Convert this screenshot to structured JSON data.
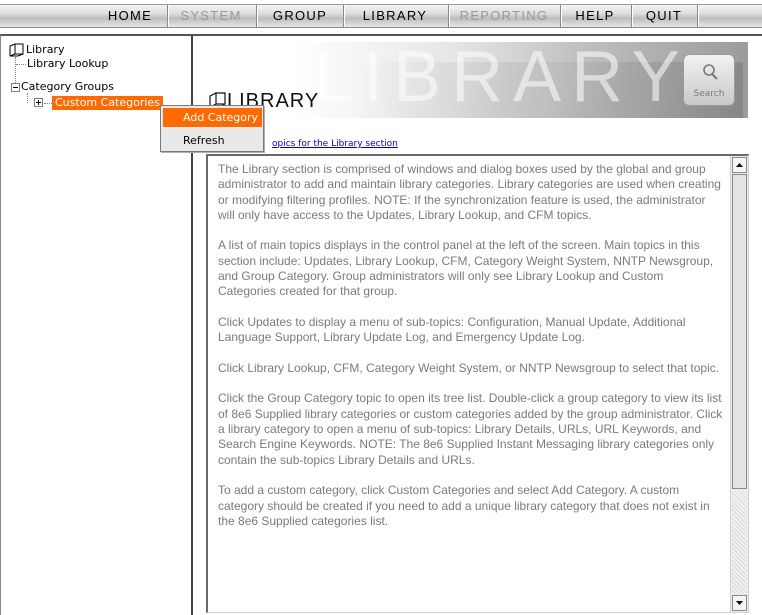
{
  "menu": {
    "items": [
      {
        "label": "HOME",
        "enabled": true
      },
      {
        "label": "SYSTEM",
        "enabled": false
      },
      {
        "label": "GROUP",
        "enabled": true
      },
      {
        "label": "LIBRARY",
        "enabled": true
      },
      {
        "label": "REPORTING",
        "enabled": false
      },
      {
        "label": "HELP",
        "enabled": true
      },
      {
        "label": "QUIT",
        "enabled": true
      }
    ]
  },
  "tree": {
    "root_label": "Library",
    "lookup_label": "Library Lookup",
    "category_groups_label": "Category Groups",
    "custom_categories_label": "Custom Categories"
  },
  "context_menu": {
    "items": [
      {
        "label": "Add Category",
        "active": true
      },
      {
        "label": "Refresh",
        "active": false
      }
    ]
  },
  "header": {
    "title": "LIBRARY",
    "watermark": "LIBRARY",
    "search_label": "Search",
    "subtopics_link": "opics for the Library section"
  },
  "content": {
    "paragraphs": [
      "The Library section is comprised of windows and dialog boxes used by the global and group administrator to add and maintain library categories. Library categories are used when creating or modifying filtering profiles. NOTE: If the synchronization feature is used, the administrator will only have access to the Updates, Library Lookup, and CFM topics.",
      "A list of main topics displays in the control panel at the left of the screen. Main topics in this section include: Updates, Library Lookup, CFM, Category Weight System, NNTP Newsgroup, and Group Category. Group administrators will only see Library Lookup and Custom Categories created for that group.",
      "Click Updates to display a menu of sub-topics: Configuration, Manual Update, Additional Language Support, Library Update Log, and Emergency Update Log.",
      "Click Library Lookup, CFM, Category Weight System, or NNTP Newsgroup to select that topic.",
      "Click the Group Category topic to open its tree list. Double-click a group category to view its list of 8e6 Supplied library categories or custom categories added by the group administrator. Click a library category to open a menu of sub-topics: Library Details, URLs, URL Keywords, and Search Engine Keywords. NOTE: The 8e6 Supplied Instant Messaging library categories only contain the sub-topics Library Details and URLs.",
      "To add a custom category, click Custom Categories and select Add Category. A custom category should be created if you need to add a unique library category that does not exist in the 8e6 Supplied categories list."
    ]
  },
  "colors": {
    "accent": "#ff6a00",
    "link": "#0000cc",
    "body_text": "#7a7a7a"
  }
}
